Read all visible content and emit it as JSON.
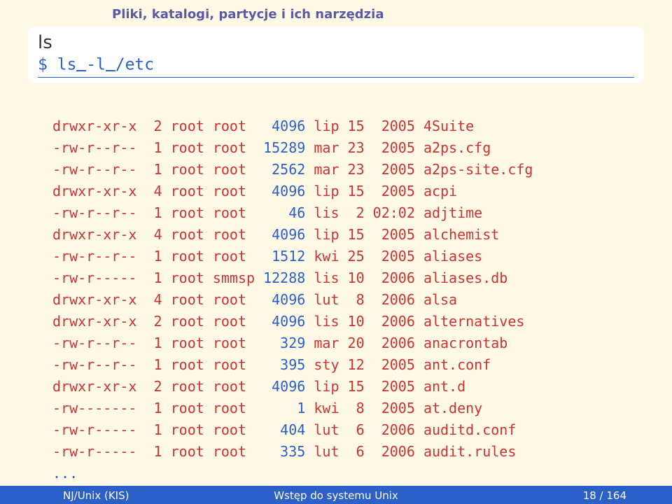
{
  "section_header": "Pliki, katalogi, partycje i ich narzędzia",
  "title": "ls",
  "prompt": "$",
  "cmd_parts": [
    "ls",
    "-l",
    "/etc"
  ],
  "columns": [
    "perm",
    "links",
    "user",
    "group",
    "size",
    "mon",
    "day",
    "time_or_year",
    "name"
  ],
  "rows": [
    {
      "perm": "drwxr-xr-x",
      "links": "2",
      "user": "root",
      "group": "root",
      "size": "4096",
      "mon": "lip",
      "day": "15",
      "tmy": "2005",
      "name": "4Suite"
    },
    {
      "perm": "-rw-r--r--",
      "links": "1",
      "user": "root",
      "group": "root",
      "size": "15289",
      "mon": "mar",
      "day": "23",
      "tmy": "2005",
      "name": "a2ps.cfg"
    },
    {
      "perm": "-rw-r--r--",
      "links": "1",
      "user": "root",
      "group": "root",
      "size": "2562",
      "mon": "mar",
      "day": "23",
      "tmy": "2005",
      "name": "a2ps-site.cfg"
    },
    {
      "perm": "drwxr-xr-x",
      "links": "4",
      "user": "root",
      "group": "root",
      "size": "4096",
      "mon": "lip",
      "day": "15",
      "tmy": "2005",
      "name": "acpi"
    },
    {
      "perm": "-rw-r--r--",
      "links": "1",
      "user": "root",
      "group": "root",
      "size": "46",
      "mon": "lis",
      "day": "2",
      "tmy": "02:02",
      "name": "adjtime"
    },
    {
      "perm": "drwxr-xr-x",
      "links": "4",
      "user": "root",
      "group": "root",
      "size": "4096",
      "mon": "lip",
      "day": "15",
      "tmy": "2005",
      "name": "alchemist"
    },
    {
      "perm": "-rw-r--r--",
      "links": "1",
      "user": "root",
      "group": "root",
      "size": "1512",
      "mon": "kwi",
      "day": "25",
      "tmy": "2005",
      "name": "aliases"
    },
    {
      "perm": "-rw-r-----",
      "links": "1",
      "user": "root",
      "group": "smmsp",
      "size": "12288",
      "mon": "lis",
      "day": "10",
      "tmy": "2006",
      "name": "aliases.db"
    },
    {
      "perm": "drwxr-xr-x",
      "links": "4",
      "user": "root",
      "group": "root",
      "size": "4096",
      "mon": "lut",
      "day": "8",
      "tmy": "2006",
      "name": "alsa"
    },
    {
      "perm": "drwxr-xr-x",
      "links": "2",
      "user": "root",
      "group": "root",
      "size": "4096",
      "mon": "lis",
      "day": "10",
      "tmy": "2006",
      "name": "alternatives"
    },
    {
      "perm": "-rw-r--r--",
      "links": "1",
      "user": "root",
      "group": "root",
      "size": "329",
      "mon": "mar",
      "day": "20",
      "tmy": "2006",
      "name": "anacrontab"
    },
    {
      "perm": "-rw-r--r--",
      "links": "1",
      "user": "root",
      "group": "root",
      "size": "395",
      "mon": "sty",
      "day": "12",
      "tmy": "2005",
      "name": "ant.conf"
    },
    {
      "perm": "drwxr-xr-x",
      "links": "2",
      "user": "root",
      "group": "root",
      "size": "4096",
      "mon": "lip",
      "day": "15",
      "tmy": "2005",
      "name": "ant.d"
    },
    {
      "perm": "-rw-------",
      "links": "1",
      "user": "root",
      "group": "root",
      "size": "1",
      "mon": "kwi",
      "day": "8",
      "tmy": "2005",
      "name": "at.deny"
    },
    {
      "perm": "-rw-r-----",
      "links": "1",
      "user": "root",
      "group": "root",
      "size": "404",
      "mon": "lut",
      "day": "6",
      "tmy": "2006",
      "name": "auditd.conf"
    },
    {
      "perm": "-rw-r-----",
      "links": "1",
      "user": "root",
      "group": "root",
      "size": "335",
      "mon": "lut",
      "day": "6",
      "tmy": "2006",
      "name": "audit.rules"
    }
  ],
  "ellipsis": "...",
  "footer": {
    "left": "NJ/Unix (KIS)",
    "center": "Wstęp do systemu Unix",
    "right": "18 / 164"
  }
}
